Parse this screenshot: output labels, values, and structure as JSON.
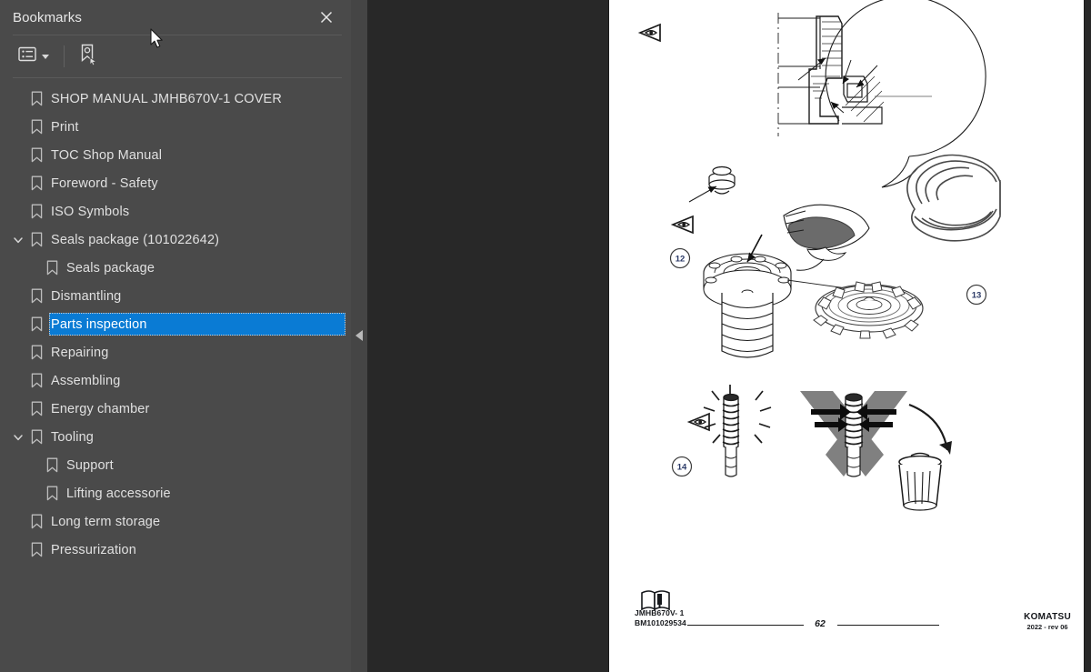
{
  "panel": {
    "title": "Bookmarks",
    "close_icon": "close-icon",
    "toolbar": {
      "options_icon": "list-options-icon",
      "options_caret_icon": "chevron-down-icon",
      "new_bookmark_icon": "new-bookmark-icon"
    },
    "collapse_handle_icon": "triangle-left-icon"
  },
  "bookmarks": [
    {
      "label": "SHOP MANUAL JMHB670V-1 COVER",
      "depth": 0,
      "expandable": false,
      "selected": false
    },
    {
      "label": "Print",
      "depth": 0,
      "expandable": false,
      "selected": false
    },
    {
      "label": "TOC Shop Manual",
      "depth": 0,
      "expandable": false,
      "selected": false
    },
    {
      "label": "Foreword - Safety",
      "depth": 0,
      "expandable": false,
      "selected": false
    },
    {
      "label": "ISO Symbols",
      "depth": 0,
      "expandable": false,
      "selected": false
    },
    {
      "label": "Seals package (101022642)",
      "depth": 0,
      "expandable": true,
      "expanded": true,
      "selected": false
    },
    {
      "label": "Seals package",
      "depth": 1,
      "expandable": false,
      "selected": false
    },
    {
      "label": "Dismantling",
      "depth": 0,
      "expandable": false,
      "selected": false
    },
    {
      "label": "Parts inspection",
      "depth": 0,
      "expandable": false,
      "selected": true
    },
    {
      "label": "Repairing",
      "depth": 0,
      "expandable": false,
      "selected": false
    },
    {
      "label": "Assembling",
      "depth": 0,
      "expandable": false,
      "selected": false
    },
    {
      "label": "Energy chamber",
      "depth": 0,
      "expandable": false,
      "selected": false
    },
    {
      "label": "Tooling",
      "depth": 0,
      "expandable": true,
      "expanded": true,
      "selected": false
    },
    {
      "label": "Support",
      "depth": 1,
      "expandable": false,
      "selected": false
    },
    {
      "label": "Lifting accessorie",
      "depth": 1,
      "expandable": false,
      "selected": false
    },
    {
      "label": "Long term storage",
      "depth": 0,
      "expandable": false,
      "selected": false
    },
    {
      "label": "Pressurization",
      "depth": 0,
      "expandable": false,
      "selected": false
    }
  ],
  "document": {
    "footer": {
      "model": "JMHB670V- 1",
      "part_number": "BM101029534",
      "page_number": "62",
      "brand": "KOMATSU",
      "revision": "2022 -  rev 06"
    },
    "callouts": [
      {
        "number": "12"
      },
      {
        "number": "13"
      },
      {
        "number": "14"
      }
    ],
    "figure_icons": [
      "inspect-eye-icon",
      "inspect-eye-icon",
      "inspect-eye-icon",
      "reject-x-icon",
      "trash-bin-icon",
      "gloved-hand-icon"
    ]
  },
  "colors": {
    "panel_bg": "#4a4a4a",
    "viewer_bg": "#282828",
    "selection": "#0a7bd4",
    "page_bg": "#ffffff",
    "callout_text": "#2b3a67"
  }
}
